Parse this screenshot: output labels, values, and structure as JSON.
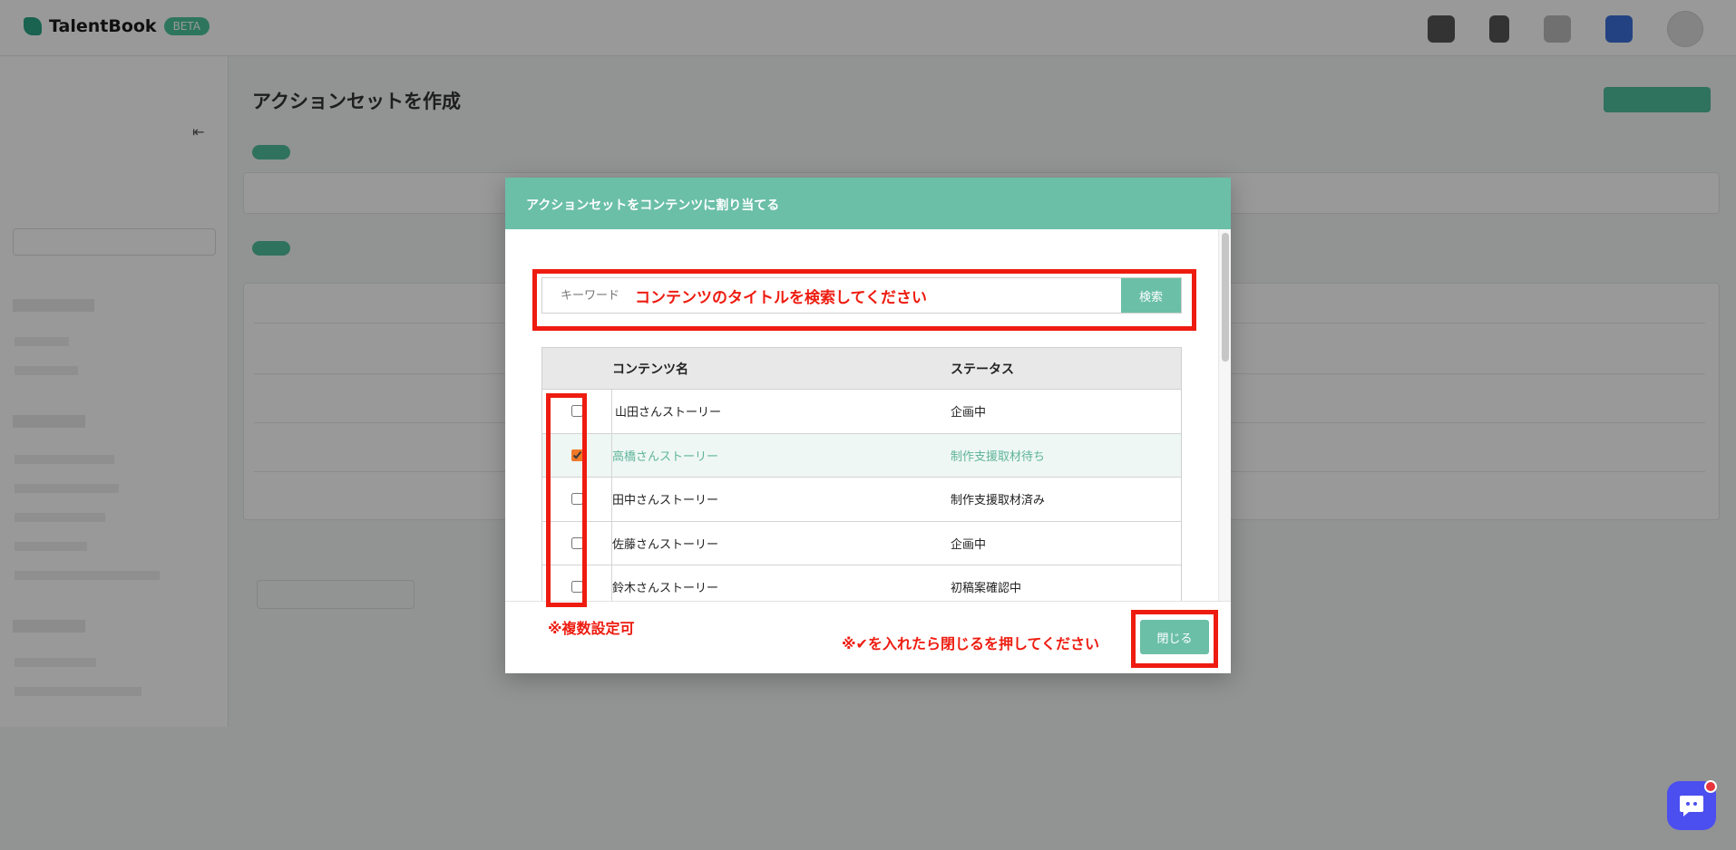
{
  "app": {
    "brand": "TalentBook",
    "brand_badge": "BETA"
  },
  "page": {
    "title": "アクションセットを作成"
  },
  "modal": {
    "title": "アクションセットをコンテンツに割り当てる",
    "search": {
      "placeholder": "キーワード",
      "button_label": "検索"
    },
    "table": {
      "headers": {
        "name": "コンテンツ名",
        "status": "ステータス"
      },
      "rows": [
        {
          "name": "山田さんストーリー",
          "status": "企画中",
          "checked": false
        },
        {
          "name": "高橋さんストーリー",
          "status": "制作支援取材待ち",
          "checked": true
        },
        {
          "name": "田中さんストーリー",
          "status": "制作支援取材済み",
          "checked": false
        },
        {
          "name": "佐藤さんストーリー",
          "status": "企画中",
          "checked": false
        },
        {
          "name": "鈴木さんストーリー",
          "status": "初稿案確認中",
          "checked": false
        }
      ]
    },
    "close_label": "閉じる"
  },
  "annotations": {
    "search_hint": "コンテンツのタイトルを検索してください",
    "multi_hint": "※複数設定可",
    "close_hint": "※✔を入れたら閉じるを押してください"
  },
  "colors": {
    "accent": "#6bbfa7",
    "annotation_red": "#ee1c10",
    "checkbox": "#f07a28",
    "chat": "#4b4ff0"
  },
  "icons": {
    "chat": "chat-bubble-icon",
    "collapse": "sidebar-collapse-icon"
  }
}
